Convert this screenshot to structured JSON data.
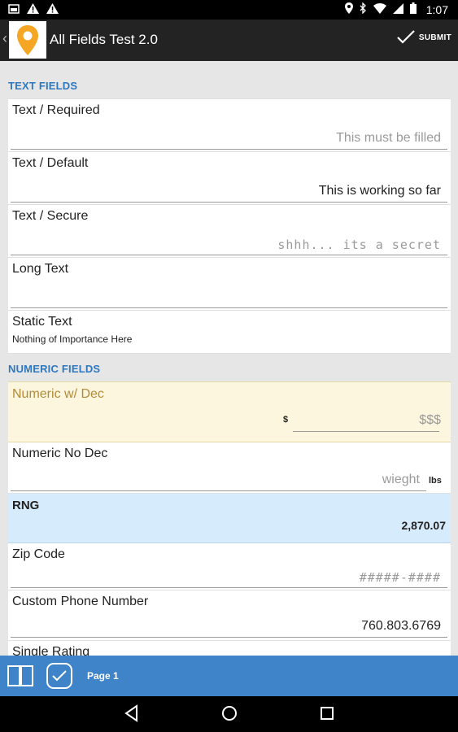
{
  "status_bar": {
    "time": "1:07",
    "icons": [
      "image-notification-icon",
      "warning-icon",
      "warning-icon",
      "location-icon",
      "bluetooth-icon",
      "wifi-icon",
      "signal-icon",
      "battery-icon"
    ]
  },
  "action_bar": {
    "title": "All Fields Test 2.0",
    "submit_label": "SUBMIT",
    "logo_icon": "map-pin-icon",
    "accent_color": "#f5a623"
  },
  "sections": {
    "text": {
      "header": "TEXT FIELDS",
      "fields": {
        "required": {
          "label": "Text / Required",
          "placeholder": "This must be filled"
        },
        "default": {
          "label": "Text / Default",
          "value": "This is working so far"
        },
        "secure": {
          "label": "Text / Secure",
          "placeholder": "shhh... its a secret"
        },
        "long": {
          "label": "Long Text",
          "value": ""
        },
        "static": {
          "label": "Static Text",
          "value": "Nothing of Importance Here"
        }
      }
    },
    "numeric": {
      "header": "NUMERIC FIELDS",
      "fields": {
        "num_dec": {
          "label": "Numeric w/ Dec",
          "prefix": "$",
          "placeholder": "$$$"
        },
        "num_nodec": {
          "label": "Numeric No Dec",
          "placeholder": "wieght",
          "suffix": "lbs"
        },
        "rng": {
          "label": "RNG",
          "value": "2,870.07"
        },
        "zip": {
          "label": "Zip Code",
          "placeholder": "#####-####"
        },
        "phone": {
          "label": "Custom Phone Number",
          "value": "760.803.6769"
        },
        "rating": {
          "label": "Single Rating"
        }
      }
    }
  },
  "bottom_bar": {
    "page_label": "Page 1"
  },
  "colors": {
    "header_blue": "#2e78bf",
    "toolbar_blue": "#3f84c8",
    "highlight_yellow": "#fcf6de",
    "highlight_blue": "#d6ebfb"
  }
}
